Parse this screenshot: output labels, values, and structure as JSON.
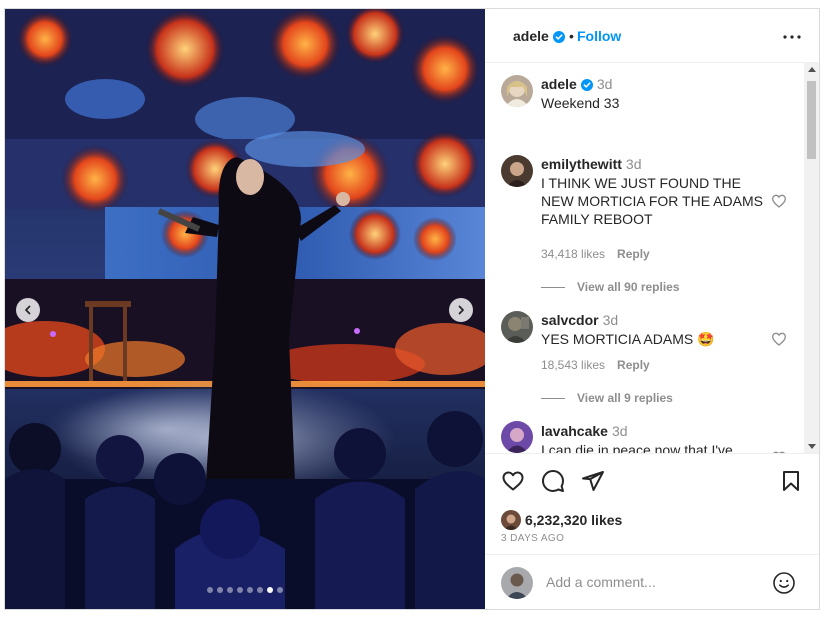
{
  "post": {
    "username": "adele",
    "follow_label": "Follow",
    "separator": "•"
  },
  "caption": {
    "username": "adele",
    "time": "3d",
    "text": "Weekend 33"
  },
  "comments": [
    {
      "username": "emilythewitt",
      "time": "3d",
      "text": "I THINK WE JUST FOUND THE NEW MORTICIA FOR THE ADAMS FAMILY REBOOT",
      "likes": "34,418 likes",
      "reply": "Reply",
      "view_replies": "View all 90 replies"
    },
    {
      "username": "salvcdor",
      "time": "3d",
      "text": "YES MORTICIA ADAMS 🤩",
      "likes": "18,543 likes",
      "reply": "Reply",
      "view_replies": "View all 9 replies"
    },
    {
      "username": "lavahcake",
      "time": "3d",
      "text": "I can die in peace now that I've"
    }
  ],
  "footer": {
    "likes": "6,232,320 likes",
    "date": "3 DAYS AGO",
    "comment_placeholder": "Add a comment..."
  },
  "carousel": {
    "total": 8,
    "active_index": 6
  },
  "colors": {
    "link_blue": "#0095f6",
    "verified_blue": "#0095f6"
  }
}
